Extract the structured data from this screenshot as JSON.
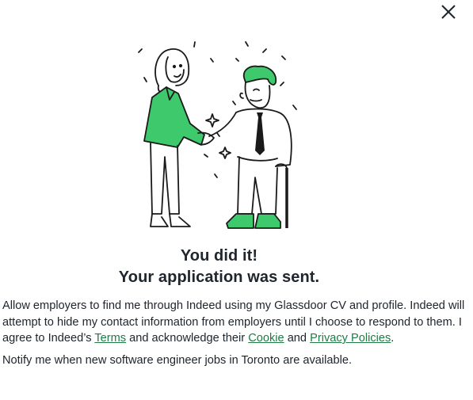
{
  "dialog": {
    "close_icon": "close-icon",
    "illustration_icon": "handshake-illustration",
    "headline_line1": "You did it!",
    "headline_line2": "Your application was sent.",
    "consent": {
      "text_before_terms": "Allow employers to find me through Indeed using my Glassdoor CV and profile. Indeed will attempt to hide my contact information from employers until I choose to respond to them. I agree to Indeed’s ",
      "terms_link": "Terms",
      "text_after_terms": " and acknowledge their ",
      "cookie_link": "Cookie",
      "text_and": " and ",
      "privacy_link": "Privacy Policies",
      "text_end": "."
    },
    "notify_text": "Notify me when new software engineer jobs in Toronto are available."
  },
  "colors": {
    "accent_green": "#3ec96d",
    "link_green": "#1f7a45",
    "ink": "#20262e"
  }
}
